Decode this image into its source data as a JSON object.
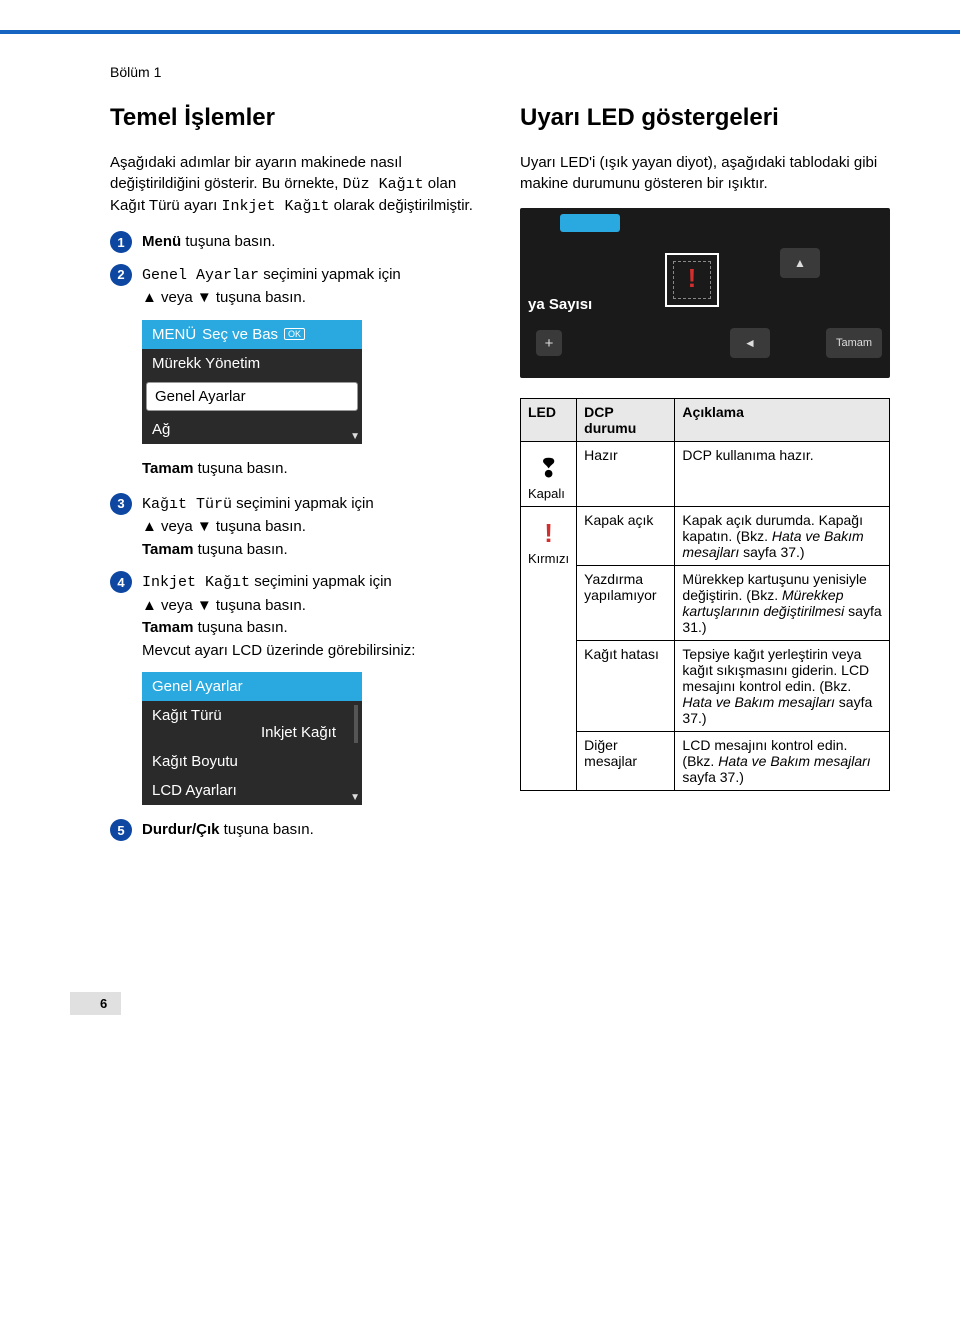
{
  "chapter": "Bölüm 1",
  "left": {
    "heading": "Temel İşlemler",
    "intro_a": "Aşağıdaki adımlar bir ayarın makinede nasıl değiştirildiğini gösterir. Bu örnekte, ",
    "intro_mono1": "Düz Kağıt",
    "intro_b": " olan Kağıt Türü ayarı ",
    "intro_mono2": "Inkjet Kağıt",
    "intro_c": " olarak değiştirilmiştir.",
    "step1_bold": "Menü",
    "step1_rest": " tuşuna basın.",
    "step2_mono": "Genel Ayarlar",
    "step2_rest": " seçimini yapmak için ",
    "step2_arrows": "▲ veya ▼ tuşuna basın.",
    "lcd1": {
      "title_a": "MENÜ",
      "title_b": "Seç ve Bas",
      "ok": "OK",
      "row1": "Mürekk Yönetim",
      "selected": "Genel Ayarlar",
      "row3": "Ağ"
    },
    "after_lcd1_bold": "Tamam",
    "after_lcd1_rest": " tuşuna basın.",
    "step3_mono": "Kağıt Türü",
    "step3_rest": " seçimini yapmak için ",
    "step3_arrows": "▲ veya ▼ tuşuna basın.",
    "step3_bold": "Tamam",
    "step3_tail": " tuşuna basın.",
    "step4_mono": "Inkjet Kağıt",
    "step4_rest": " seçimini yapmak için ",
    "step4_arrows": "▲ veya ▼ tuşuna basın.",
    "step4_bold": "Tamam",
    "step4_tail": " tuşuna basın.",
    "step4_extra": "Mevcut ayarı LCD üzerinde görebilirsiniz:",
    "lcd2": {
      "title": "Genel Ayarlar",
      "row1": "Kağıt Türü",
      "row1_sub": "Inkjet Kağıt",
      "row2": "Kağıt Boyutu",
      "row3": "LCD Ayarları"
    },
    "step5_bold": "Durdur/Çık",
    "step5_rest": " tuşuna basın."
  },
  "right": {
    "heading": "Uyarı LED göstergeleri",
    "intro": "Uyarı LED'i (ışık yayan diyot), aşağıdaki tablodaki gibi makine durumunu gösteren bir ışıktır.",
    "photo": {
      "label": "ya Sayısı",
      "btn_right": "Tamam",
      "exclaim": "!"
    },
    "table": {
      "h1": "LED",
      "h2": "DCP durumu",
      "h3": "Açıklama",
      "off_label": "Kapalı",
      "red_label": "Kırmızı",
      "r1_s": "Hazır",
      "r1_d": "DCP kullanıma hazır.",
      "r2_s": "Kapak açık",
      "r2_d_a": "Kapak açık durumda. Kapağı kapatın. (Bkz. ",
      "r2_d_i": "Hata ve Bakım mesajları",
      "r2_d_b": " sayfa 37.)",
      "r3_s": "Yazdırma yapılamıyor",
      "r3_d_a": "Mürekkep kartuşunu yenisiyle değiştirin. (Bkz. ",
      "r3_d_i": "Mürekkep kartuşlarının değiştirilmesi",
      "r3_d_b": " sayfa 31.)",
      "r4_s": "Kağıt hatası",
      "r4_d_a": "Tepsiye kağıt yerleştirin veya kağıt sıkışmasını giderin. LCD mesajını kontrol edin. (Bkz. ",
      "r4_d_i": "Hata ve Bakım mesajları",
      "r4_d_b": " sayfa 37.)",
      "r5_s": "Diğer mesajlar",
      "r5_d_a": "LCD mesajını kontrol edin. (Bkz. ",
      "r5_d_i": "Hata ve Bakım mesajları",
      "r5_d_b": " sayfa 37.)"
    }
  },
  "pagenum": "6"
}
